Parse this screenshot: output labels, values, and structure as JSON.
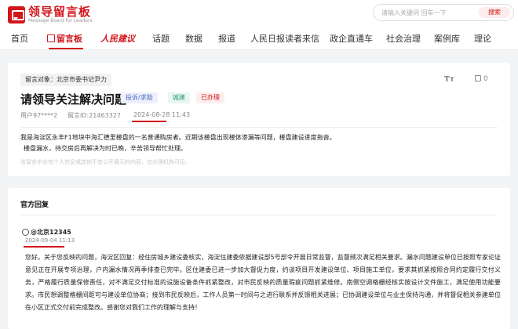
{
  "header": {
    "logo_cn": "领导留言板",
    "logo_en": "Message Board for Leaders",
    "search_placeholder": "请输入关键词 回车一下",
    "search_button": "搜索"
  },
  "nav": {
    "items": [
      "首页",
      "留言板",
      "人民建议",
      "话题",
      "数据",
      "报道",
      "人民日报读者来信",
      "政企直通车",
      "社会治理",
      "案例库",
      "理论"
    ],
    "active_index": 1
  },
  "message": {
    "recipient": "留言对象：北京市委书记尹力",
    "likes": "0",
    "title": "请领导关注解决问题",
    "tags": {
      "type": "投诉/求助",
      "field": "城建",
      "status": "已办理"
    },
    "user": "用户97****2",
    "message_id": "留言ID:21463327",
    "date": "2024-08-28 11:43",
    "content": [
      "我是海淀区永丰F1地块中海汇德里楼盘的一名普通购房者。近期该楼盘出现楼体渗漏等问题，楼盘建设进度拖沓。",
      "楼盘漏水，待交房后再解决为时已晚，辛苦领导帮忙处理。"
    ],
    "disclaimer": "该留言中含有个人信息或其他不宜公开展示的内容，仅办理机构可见。"
  },
  "reply": {
    "heading": "官方回复",
    "org": "@北京12345",
    "date": "2024-09-04 11:13",
    "text": "您好。关于您反映的问题，海淀区回复：经住房城乡建设委核实，海淀住建委依据建设部5号部令开展日常监督，监督频次满足相关要求。漏水问题建设单位已按照专家论证意见正在开展专项治理，户内漏水情况再季排查已完毕。区住建委已进一步加大督促力度，约谈项目开发建设单位、项目施工单位，要求其抓紧按照合同约定履行交付义务，严格履行质量保修责任，对不满足交付标准的设施设备条件抓紧整改，对市民反映的质量瑕疵问题抓紧维修。南侧空调格栅经核实按设计文件施工，满足使用功能要求。市民想调整格栅间距可与建设单位协商；接到市民反映后，工作人员第一时间与之进行联系并反馈相关进展；已协调建设单位与业主保持沟通，并将督促相关参建单位在小区正式交付前完成整改。感谢您对我们工作的理解与支持！"
  },
  "colors": {
    "brand": "#d2161c"
  }
}
